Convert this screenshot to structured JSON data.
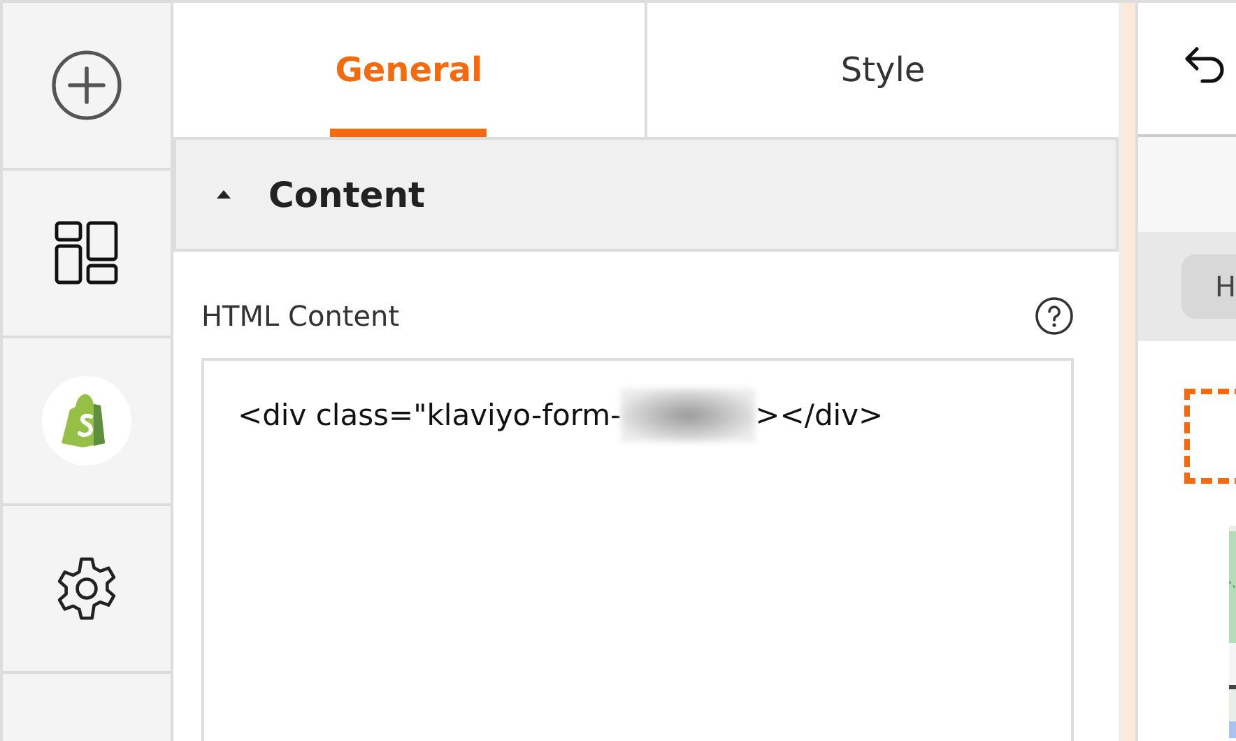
{
  "sidebar": {
    "items": [
      {
        "kind": "add"
      },
      {
        "kind": "layout"
      },
      {
        "kind": "shop"
      },
      {
        "kind": "settings"
      },
      {
        "kind": "blank"
      }
    ]
  },
  "tabs": [
    {
      "label": "General",
      "selected": true
    },
    {
      "label": "Style",
      "selected": false
    }
  ],
  "section": {
    "title": "Content",
    "expanded": true
  },
  "html_content": {
    "label": "HTML Content",
    "code_before": "<div class=\"klaviyo-form-",
    "redacted": true,
    "code_after": "></div>"
  },
  "preview": {
    "button_label": "H"
  }
}
